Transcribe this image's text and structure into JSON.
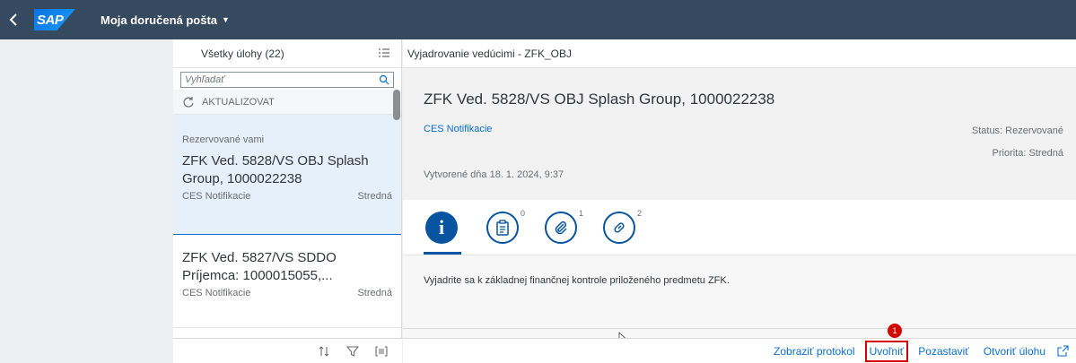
{
  "shell": {
    "logo_text": "SAP",
    "app_title": "Moja doručená pošta"
  },
  "master": {
    "header_title": "Všetky úlohy (22)",
    "search_placeholder": "Vyhľadať",
    "refresh_label": "AKTUALIZOVAT",
    "items": [
      {
        "reserved_label": "Rezervované vami",
        "title": "ZFK Ved. 5828/VS OBJ Splash Group, 1000022238",
        "category": "CES Notifikacie",
        "priority": "Stredná"
      },
      {
        "title": "ZFK Ved. 5827/VS SDDO Príjemca: 1000015055,...",
        "category": "CES Notifikacie",
        "priority": "Stredná"
      }
    ]
  },
  "detail": {
    "top_title": "Vyjadrovanie vedúcimi - ZFK_OBJ",
    "object_title": "ZFK Ved. 5828/VS OBJ Splash Group, 1000022238",
    "category_link": "CES Notifikacie",
    "status": "Status: Rezervované",
    "priority": "Priorita: Stredná",
    "created": "Vytvorené dňa 18. 1. 2024, 9:37",
    "tabs": [
      {
        "icon": "info-icon",
        "glyph": "i",
        "count": ""
      },
      {
        "icon": "notes-icon",
        "count": "0"
      },
      {
        "icon": "attachment-icon",
        "count": "1"
      },
      {
        "icon": "link-icon",
        "count": "2"
      }
    ],
    "description": "Vyjadrite sa k základnej finančnej kontrole priloženého predmetu ZFK."
  },
  "footer": {
    "show_log": "Zobraziť protokol",
    "release": "Uvoľniť",
    "suspend": "Pozastaviť",
    "open_task": "Otvoriť úlohu",
    "badge": "1"
  },
  "colors": {
    "shellbar": "#354a5f",
    "accent": "#0a6ed1",
    "highlight": "#d40000"
  }
}
